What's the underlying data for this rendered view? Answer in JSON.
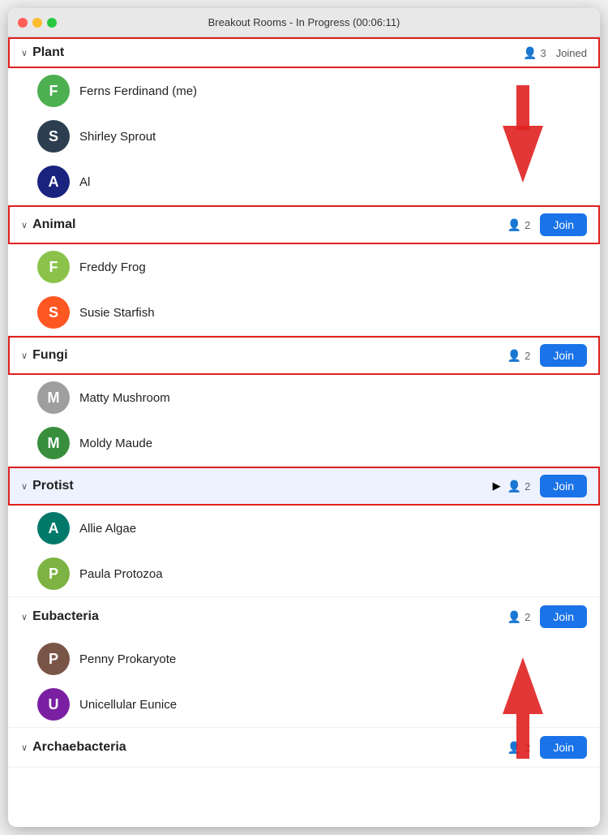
{
  "window": {
    "title": "Breakout Rooms - In Progress (00:06:11)"
  },
  "rooms": [
    {
      "id": "plant",
      "name": "Plant",
      "count": 3,
      "status": "joined",
      "outlined": true,
      "highlighted": false,
      "participants": [
        {
          "id": "ferns",
          "name": "Ferns Ferdinand (me)",
          "avatar_letter": "F",
          "avatar_class": "av-green"
        },
        {
          "id": "shirley",
          "name": "Shirley Sprout",
          "avatar_letter": "S",
          "avatar_class": "av-dark"
        },
        {
          "id": "al",
          "name": "Al",
          "avatar_letter": "A",
          "avatar_class": "av-blue-dark"
        }
      ]
    },
    {
      "id": "animal",
      "name": "Animal",
      "count": 2,
      "status": "join",
      "outlined": true,
      "highlighted": false,
      "participants": [
        {
          "id": "freddy",
          "name": "Freddy Frog",
          "avatar_letter": "F",
          "avatar_class": "av-lime"
        },
        {
          "id": "susie",
          "name": "Susie Starfish",
          "avatar_letter": "S",
          "avatar_class": "av-orange"
        }
      ]
    },
    {
      "id": "fungi",
      "name": "Fungi",
      "count": 2,
      "status": "join",
      "outlined": true,
      "highlighted": false,
      "participants": [
        {
          "id": "matty",
          "name": "Matty Mushroom",
          "avatar_letter": "M",
          "avatar_class": "av-gray"
        },
        {
          "id": "moldy",
          "name": "Moldy Maude",
          "avatar_letter": "M",
          "avatar_class": "av-green2"
        }
      ]
    },
    {
      "id": "protist",
      "name": "Protist",
      "count": 2,
      "status": "join",
      "outlined": true,
      "highlighted": true,
      "participants": [
        {
          "id": "allie",
          "name": "Allie Algae",
          "avatar_letter": "A",
          "avatar_class": "av-teal"
        },
        {
          "id": "paula",
          "name": "Paula Protozoa",
          "avatar_letter": "P",
          "avatar_class": "av-light-green"
        }
      ]
    },
    {
      "id": "eubacteria",
      "name": "Eubacteria",
      "count": 2,
      "status": "join",
      "outlined": false,
      "highlighted": false,
      "participants": [
        {
          "id": "penny",
          "name": "Penny Prokaryote",
          "avatar_letter": "P",
          "avatar_class": "av-brown"
        },
        {
          "id": "unicellular",
          "name": "Unicellular Eunice",
          "avatar_letter": "U",
          "avatar_class": "av-purple"
        }
      ]
    },
    {
      "id": "archaebacteria",
      "name": "Archaebacteria",
      "count": 2,
      "status": "join",
      "outlined": false,
      "highlighted": false,
      "participants": []
    }
  ],
  "labels": {
    "join": "Join",
    "joined": "Joined"
  }
}
